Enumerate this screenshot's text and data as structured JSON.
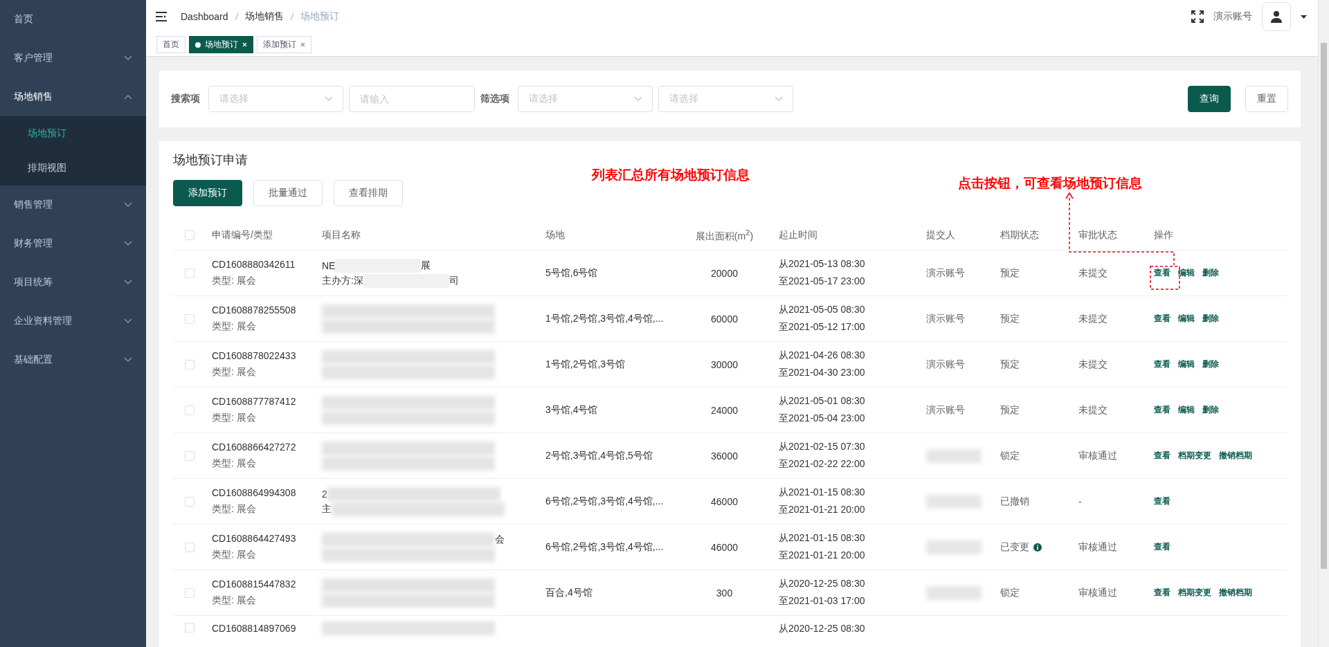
{
  "sidebar": {
    "items": [
      {
        "label": "首页",
        "has_children": false,
        "expanded": false
      },
      {
        "label": "客户管理",
        "has_children": true,
        "expanded": false
      },
      {
        "label": "场地销售",
        "has_children": true,
        "expanded": true,
        "children": [
          {
            "label": "场地预订",
            "selected": true
          },
          {
            "label": "排期视图",
            "selected": false
          }
        ]
      },
      {
        "label": "销售管理",
        "has_children": true,
        "expanded": false
      },
      {
        "label": "财务管理",
        "has_children": true,
        "expanded": false
      },
      {
        "label": "项目统筹",
        "has_children": true,
        "expanded": false
      },
      {
        "label": "企业资料管理",
        "has_children": true,
        "expanded": false
      },
      {
        "label": "基础配置",
        "has_children": true,
        "expanded": false
      }
    ]
  },
  "header": {
    "breadcrumb": [
      "Dashboard",
      "场地销售",
      "场地预订"
    ],
    "user": "演示账号"
  },
  "tags": [
    {
      "label": "首页",
      "selected": false,
      "closable": false
    },
    {
      "label": "场地预订",
      "selected": true,
      "closable": true
    },
    {
      "label": "添加预订",
      "selected": false,
      "closable": true
    }
  ],
  "filters": {
    "search_label": "搜索项",
    "search_select": {
      "placeholder": "请选择"
    },
    "search_input": {
      "placeholder": "请输入"
    },
    "filter_label": "筛选项",
    "filter_selects": [
      {
        "placeholder": "请选择"
      },
      {
        "placeholder": "请选择"
      }
    ],
    "buttons": [
      {
        "label": "查询",
        "kind": "primary"
      },
      {
        "label": "重置",
        "kind": "default"
      }
    ]
  },
  "table": {
    "title": "场地预订申请",
    "buttons": [
      {
        "label": "添加预订",
        "kind": "primary"
      },
      {
        "label": "批量通过",
        "kind": "default"
      },
      {
        "label": "查看排期",
        "kind": "default"
      }
    ],
    "select_all_checked": false,
    "columns": [
      "申请编号/类型",
      "项目名称",
      "场地",
      "展出面积(m$^{2}$)",
      "起止时间",
      "提交人",
      "档期状态",
      "审批状态",
      "操作"
    ],
    "rows": [
      {
        "checked": false,
        "id": "CD1608880342611",
        "type": "类型: 展会",
        "project": [
          [
            {
              "kind": "text",
              "text": "NE"
            },
            {
              "kind": "mask"
            },
            {
              "kind": "text",
              "text": "展"
            }
          ],
          [
            {
              "kind": "text",
              "text": "主办方:深"
            },
            {
              "kind": "mask"
            },
            {
              "kind": "text",
              "text": "司"
            }
          ]
        ],
        "venue": "5号馆,6号馆",
        "area": "20000",
        "start": "从2021-05-13 08:30",
        "end": "至2021-05-17 23:00",
        "submitter": {
          "kind": "text",
          "text": "演示账号"
        },
        "schedule": "预定",
        "schedule_info": false,
        "approval": "未提交",
        "actions": [
          "查看",
          "编辑",
          "删除"
        ]
      },
      {
        "checked": false,
        "id": "CD1608878255508",
        "type": "类型: 展会",
        "project": [
          [
            {
              "kind": "blur"
            }
          ],
          [
            {
              "kind": "blur"
            }
          ]
        ],
        "venue": "1号馆,2号馆,3号馆,4号馆,...",
        "area": "60000",
        "start": "从2021-05-05 08:30",
        "end": "至2021-05-12 17:00",
        "submitter": {
          "kind": "text",
          "text": "演示账号"
        },
        "schedule": "预定",
        "schedule_info": false,
        "approval": "未提交",
        "actions": [
          "查看",
          "编辑",
          "删除"
        ]
      },
      {
        "checked": false,
        "id": "CD1608878022433",
        "type": "类型: 展会",
        "project": [
          [
            {
              "kind": "blur"
            }
          ],
          [
            {
              "kind": "blur"
            }
          ]
        ],
        "venue": "1号馆,2号馆,3号馆",
        "area": "30000",
        "start": "从2021-04-26 08:30",
        "end": "至2021-04-30 23:00",
        "submitter": {
          "kind": "text",
          "text": "演示账号"
        },
        "schedule": "预定",
        "schedule_info": false,
        "approval": "未提交",
        "actions": [
          "查看",
          "编辑",
          "删除"
        ]
      },
      {
        "checked": false,
        "id": "CD1608877787412",
        "type": "类型: 展会",
        "project": [
          [
            {
              "kind": "blur"
            }
          ],
          [
            {
              "kind": "blur"
            }
          ]
        ],
        "venue": "3号馆,4号馆",
        "area": "24000",
        "start": "从2021-05-01 08:30",
        "end": "至2021-05-04 23:00",
        "submitter": {
          "kind": "text",
          "text": "演示账号"
        },
        "schedule": "预定",
        "schedule_info": false,
        "approval": "未提交",
        "actions": [
          "查看",
          "编辑",
          "删除"
        ]
      },
      {
        "checked": false,
        "id": "CD1608866427272",
        "type": "类型: 展会",
        "project": [
          [
            {
              "kind": "blur"
            }
          ],
          [
            {
              "kind": "blur"
            }
          ]
        ],
        "venue": "2号馆,3号馆,4号馆,5号馆",
        "area": "36000",
        "start": "从2021-02-15 07:30",
        "end": "至2021-02-22 22:00",
        "submitter": {
          "kind": "blur"
        },
        "schedule": "锁定",
        "schedule_info": false,
        "approval": "审核通过",
        "actions": [
          "查看",
          "档期变更",
          "撤销档期"
        ]
      },
      {
        "checked": false,
        "id": "CD1608864994308",
        "type": "类型: 展会",
        "project": [
          [
            {
              "kind": "text",
              "text": "2"
            },
            {
              "kind": "blur"
            }
          ],
          [
            {
              "kind": "text",
              "text": "主"
            },
            {
              "kind": "blur"
            }
          ]
        ],
        "venue": "6号馆,2号馆,3号馆,4号馆,...",
        "area": "46000",
        "start": "从2021-01-15 08:30",
        "end": "至2021-01-21 20:00",
        "submitter": {
          "kind": "blur"
        },
        "schedule": "已撤销",
        "schedule_info": false,
        "approval": "-",
        "actions": [
          "查看"
        ]
      },
      {
        "checked": false,
        "id": "CD1608864427493",
        "type": "类型: 展会",
        "project": [
          [
            {
              "kind": "blur"
            },
            {
              "kind": "text",
              "text": "会"
            }
          ],
          [
            {
              "kind": "blur"
            }
          ]
        ],
        "venue": "6号馆,2号馆,3号馆,4号馆,...",
        "area": "46000",
        "start": "从2021-01-15 08:30",
        "end": "至2021-01-21 20:00",
        "submitter": {
          "kind": "blur"
        },
        "schedule": "已变更",
        "schedule_info": true,
        "approval": "审核通过",
        "actions": [
          "查看"
        ]
      },
      {
        "checked": false,
        "id": "CD1608815447832",
        "type": "类型: 展会",
        "project": [
          [
            {
              "kind": "blur"
            }
          ],
          [
            {
              "kind": "blur"
            }
          ]
        ],
        "venue": "百合,4号馆",
        "area": "300",
        "start": "从2020-12-25 08:30",
        "end": "至2021-01-03 17:00",
        "submitter": {
          "kind": "blur"
        },
        "schedule": "锁定",
        "schedule_info": false,
        "approval": "审核通过",
        "actions": [
          "查看",
          "档期变更",
          "撤销档期"
        ]
      },
      {
        "checked": false,
        "id": "CD1608814897069",
        "project": [
          [
            {
              "kind": "blur"
            }
          ]
        ],
        "start": "从2020-12-25 08:30"
      }
    ]
  },
  "annotations": [
    {
      "kind": "caption",
      "text": "列表汇总所有场地预订信息"
    },
    {
      "kind": "callout",
      "text": "点击按钮，可查看场地预订信息"
    }
  ]
}
